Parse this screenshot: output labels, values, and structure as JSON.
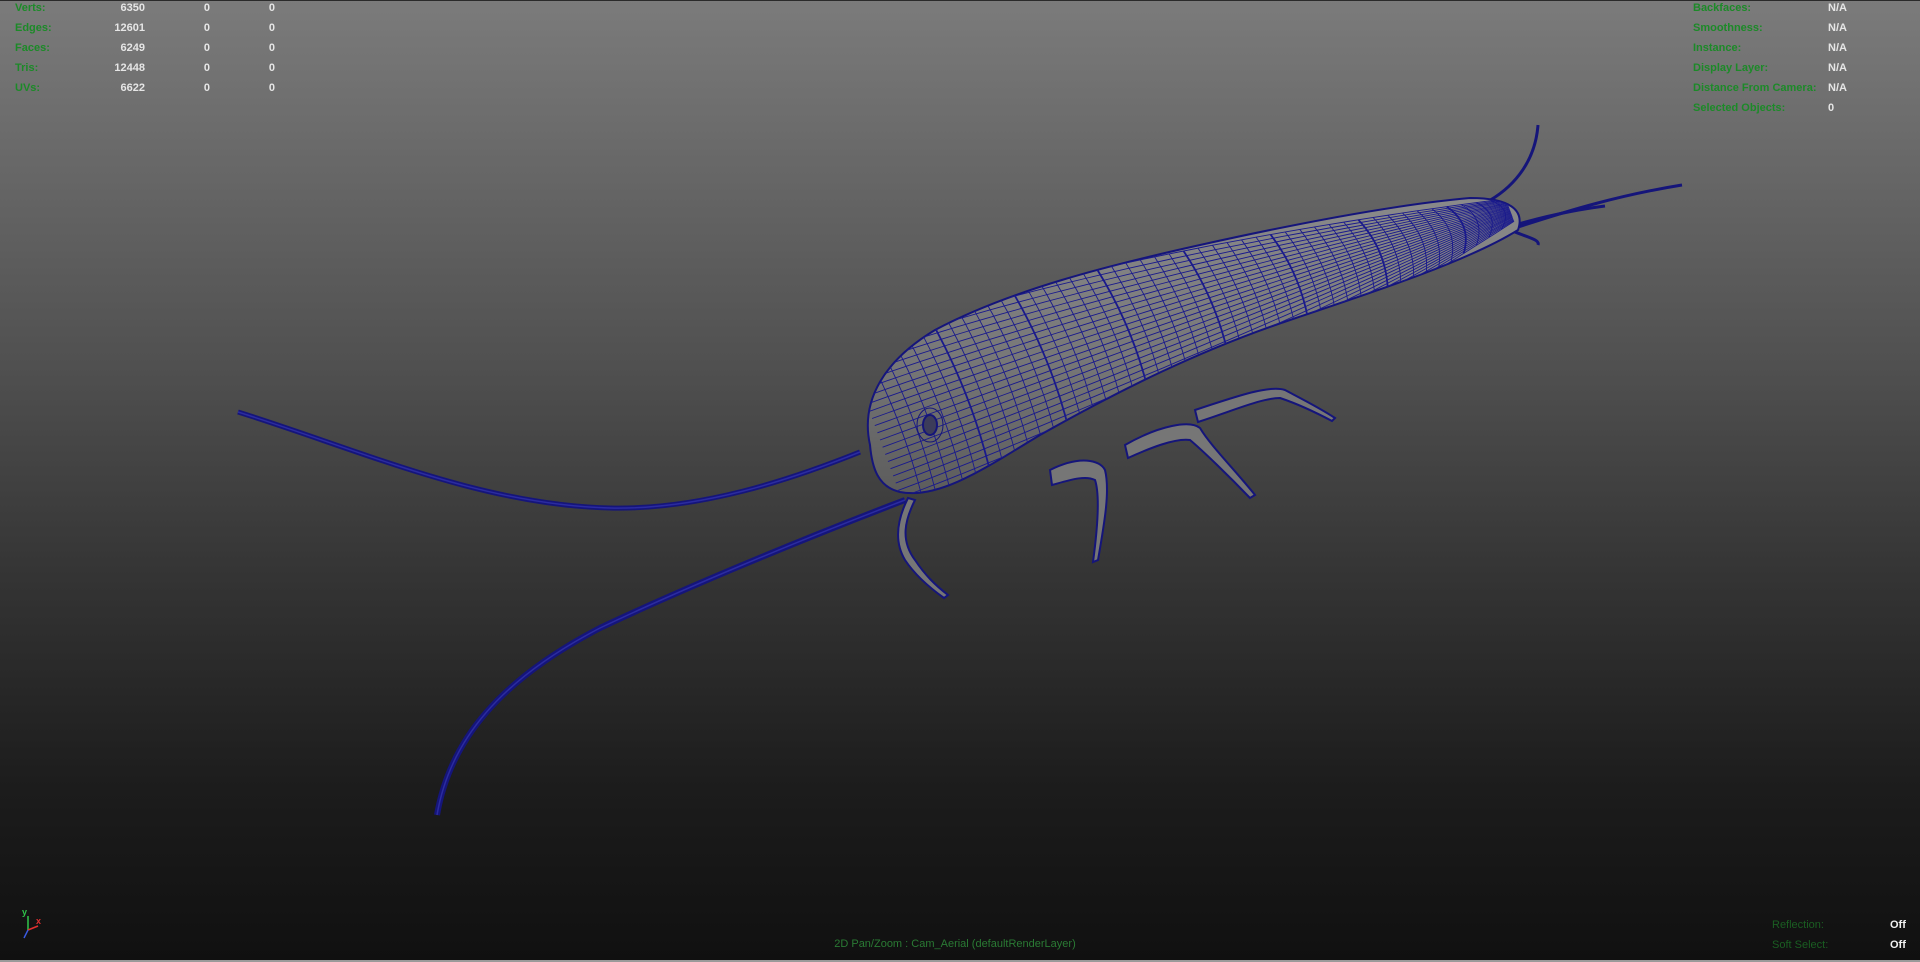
{
  "viewport": {
    "background_top": "#7b7b7b",
    "background_bottom": "#101010",
    "wire_color": "#14147a",
    "hud_label_color": "#1c8a28",
    "hud_value_color": "#e6e6e6"
  },
  "poly_count": {
    "rows": [
      {
        "label": "Verts:",
        "total": "6350",
        "selected": "0",
        "extra": "0"
      },
      {
        "label": "Edges:",
        "total": "12601",
        "selected": "0",
        "extra": "0"
      },
      {
        "label": "Faces:",
        "total": "6249",
        "selected": "0",
        "extra": "0"
      },
      {
        "label": "Tris:",
        "total": "12448",
        "selected": "0",
        "extra": "0"
      },
      {
        "label": "UVs:",
        "total": "6622",
        "selected": "0",
        "extra": "0"
      }
    ]
  },
  "object_details": {
    "rows": [
      {
        "label": "Backfaces:",
        "value": "N/A"
      },
      {
        "label": "Smoothness:",
        "value": "N/A"
      },
      {
        "label": "Instance:",
        "value": "N/A"
      },
      {
        "label": "Display Layer:",
        "value": "N/A"
      },
      {
        "label": "Distance From Camera:",
        "value": "N/A"
      },
      {
        "label": "Selected Objects:",
        "value": "0"
      }
    ]
  },
  "camera_label": "2D Pan/Zoom : Cam_Aerial (defaultRenderLayer)",
  "bottom_status": {
    "rows": [
      {
        "label": "Reflection:",
        "value": "Off"
      },
      {
        "label": "Soft Select:",
        "value": "Off"
      }
    ]
  },
  "axis_indicator": {
    "y": "y",
    "x": "x",
    "y_color": "#2fc44a",
    "x_color": "#e03030",
    "z_color": "#3a5ae0"
  },
  "model": {
    "name": "silverfish-wireframe-model"
  }
}
